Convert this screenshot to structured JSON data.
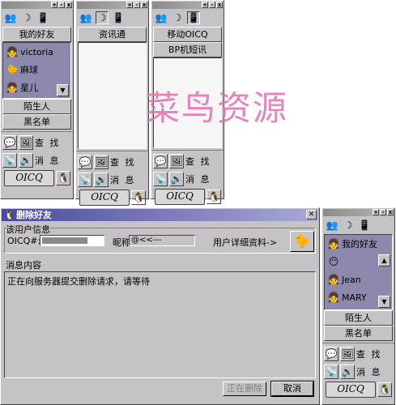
{
  "windows": [
    {
      "groups_top": [
        "我的好友"
      ],
      "friends": [
        {
          "name": "victoria",
          "icon": "girl-avatar"
        },
        {
          "name": "麻球",
          "icon": "bird-avatar"
        },
        {
          "name": "星儿",
          "icon": "girl-avatar"
        }
      ],
      "groups_bottom": [
        "陌生人",
        "黑名单"
      ]
    },
    {
      "groups_top": [
        "资讯通"
      ]
    },
    {
      "groups_top": [
        "移动OICQ",
        "BP机短讯"
      ]
    }
  ],
  "bottom": {
    "search_label": "查 找",
    "message_label": "消 息",
    "logo_text": "OICQ"
  },
  "watermark": "菜鸟资源",
  "dialog": {
    "title": "删除好友",
    "section": "该用户信息",
    "oicq_label": "OICQ#:",
    "nick_label": "昵称:",
    "nick_value": "@<<---",
    "detail_label": "用户详细资料->",
    "message_section": "消息内容",
    "message_text": "正在向服务器提交删除请求，请等待",
    "btn_deleting": "正在删除",
    "btn_cancel": "取消"
  },
  "side_window": {
    "groups_top": [
      "我的好友"
    ],
    "friends": [
      {
        "name": "",
        "icon": "face-avatar"
      },
      {
        "name": "Jean",
        "icon": "girl-avatar"
      },
      {
        "name": "MARY",
        "icon": "girl-avatar"
      }
    ],
    "groups_bottom": [
      "陌生人",
      "黑名单"
    ]
  },
  "icons": {
    "tool1": "users-icon",
    "tool2": "moon-icon",
    "tool3": "phone-icon"
  }
}
